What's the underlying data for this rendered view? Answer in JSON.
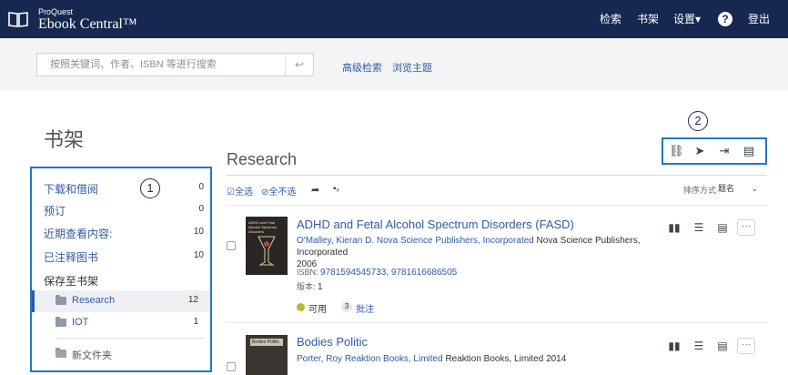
{
  "header": {
    "brand_small": "ProQuest",
    "brand_big": "Ebook Central™",
    "nav": {
      "search": "检索",
      "bookshelf": "书架",
      "settings": "设置▾",
      "help": "?",
      "logout": "登出"
    },
    "colors": {
      "bar": "#16284f"
    }
  },
  "search": {
    "placeholder": "按照关键词、作者、ISBN 等进行搜索",
    "submit_icon": "↩",
    "advanced": "高级检索",
    "browse": "浏览主题"
  },
  "page": {
    "title": "书架"
  },
  "sidebar": {
    "items": [
      {
        "label": "下载和借阅",
        "count": "0"
      },
      {
        "label": "预订",
        "count": "0"
      },
      {
        "label": "近期查看内容:",
        "count": "10"
      },
      {
        "label": "已注释图书",
        "count": "10"
      }
    ],
    "saved_label": "保存至书架",
    "folders": [
      {
        "label": "Research",
        "count": "12",
        "active": true
      },
      {
        "label": "IOT",
        "count": "1",
        "active": false
      }
    ],
    "new_folder": "新文件夹"
  },
  "callouts": {
    "one": "1",
    "two": "2"
  },
  "toolbar": {
    "icons": [
      "link-icon",
      "send-icon",
      "export-icon",
      "comment-icon"
    ],
    "glyphs": [
      "⛓",
      "➤",
      "⇥",
      "▤"
    ]
  },
  "main": {
    "folder_title": "Research",
    "select_all": "⊘全选",
    "select_none": "⊘全不选",
    "sort_label": "排序方式",
    "sort_value": "题名",
    "sort_caret": "⌄",
    "select_all_check": "☑全选",
    "move_glyph": "➦",
    "delete_glyph": "▪ₓ"
  },
  "books": [
    {
      "title": "ADHD and Fetal Alcohol Spectrum Disorders (FASD)",
      "authors": "O'Malley, Kieran D.",
      "publisher_link": "Nova Science Publishers, Incorporated",
      "publisher_text": "Nova Science Publishers, Incorporated",
      "year": "2006",
      "isbn_label": "ISBN:",
      "isbn": "9781594545733, 9781616686505",
      "edition_label": "版本:",
      "edition": "1",
      "availability": "可用",
      "notes_count": "3",
      "notes_label": "批注",
      "cover_text": "ADHD and Fetal Alcohol Spectrum Disorders"
    },
    {
      "title": "Bodies Politic",
      "authors": "Porter, Roy",
      "publisher_link": "Reaktion Books, Limited",
      "publisher_text": "Reaktion Books, Limited",
      "year": "2014",
      "cover_text": "Bodies Politic"
    }
  ],
  "row_actions": {
    "read": "▮▮",
    "toc": "☰",
    "comment": "▤",
    "more": "···"
  }
}
